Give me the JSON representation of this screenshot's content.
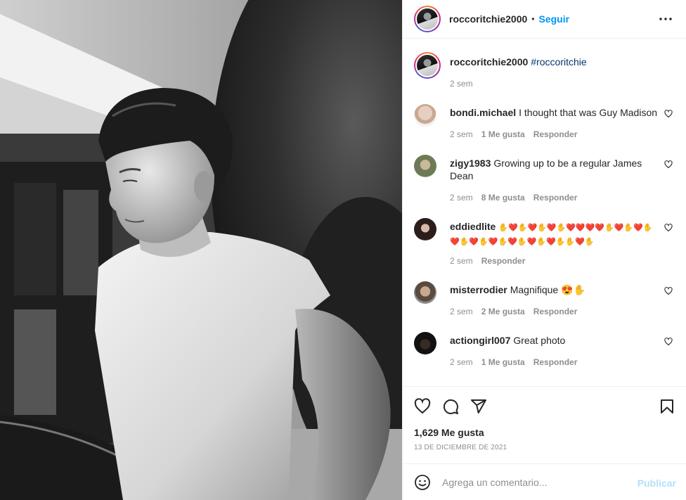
{
  "post": {
    "author": "roccoritchie2000",
    "follow_label": "Seguir",
    "separator": "•"
  },
  "caption": {
    "username": "roccoritchie2000",
    "text": "#roccoritchie",
    "time": "2 sem"
  },
  "comments": [
    {
      "username": "bondi.michael",
      "text": "I thought that was Guy Madison",
      "time": "2 sem",
      "likes": "1 Me gusta",
      "reply": "Responder"
    },
    {
      "username": "zigy1983",
      "text": "Growing up to be a regular James Dean",
      "time": "2 sem",
      "likes": "8 Me gusta",
      "reply": "Responder"
    },
    {
      "username": "eddiedlite",
      "text": "✋❤️✋❤️✋❤️✋❤️❤️❤️❤️✋❤️✋❤️✋❤️✋❤️✋❤️✋❤️✋❤️✋❤️✋✋❤️✋",
      "time": "2 sem",
      "likes": "",
      "reply": "Responder"
    },
    {
      "username": "misterrodier",
      "text": "Magnifique 😍✋",
      "time": "2 sem",
      "likes": "2 Me gusta",
      "reply": "Responder"
    },
    {
      "username": "actiongirl007",
      "text": "Great photo",
      "time": "2 sem",
      "likes": "1 Me gusta",
      "reply": "Responder"
    }
  ],
  "likes_count": "1,629 Me gusta",
  "post_date": "13 DE DICIEMBRE DE 2021",
  "composer": {
    "placeholder": "Agrega un comentario...",
    "publish_label": "Publicar"
  },
  "icons": {
    "more": "more-options-icon",
    "like": "heart-icon",
    "comment": "comment-icon",
    "share": "share-icon",
    "save": "bookmark-icon",
    "emoji": "emoji-icon"
  },
  "colors": {
    "accent": "#0095f6",
    "publish_disabled": "#b2dffc",
    "meta_text": "#8e8e8e",
    "hashtag": "#00376b"
  }
}
